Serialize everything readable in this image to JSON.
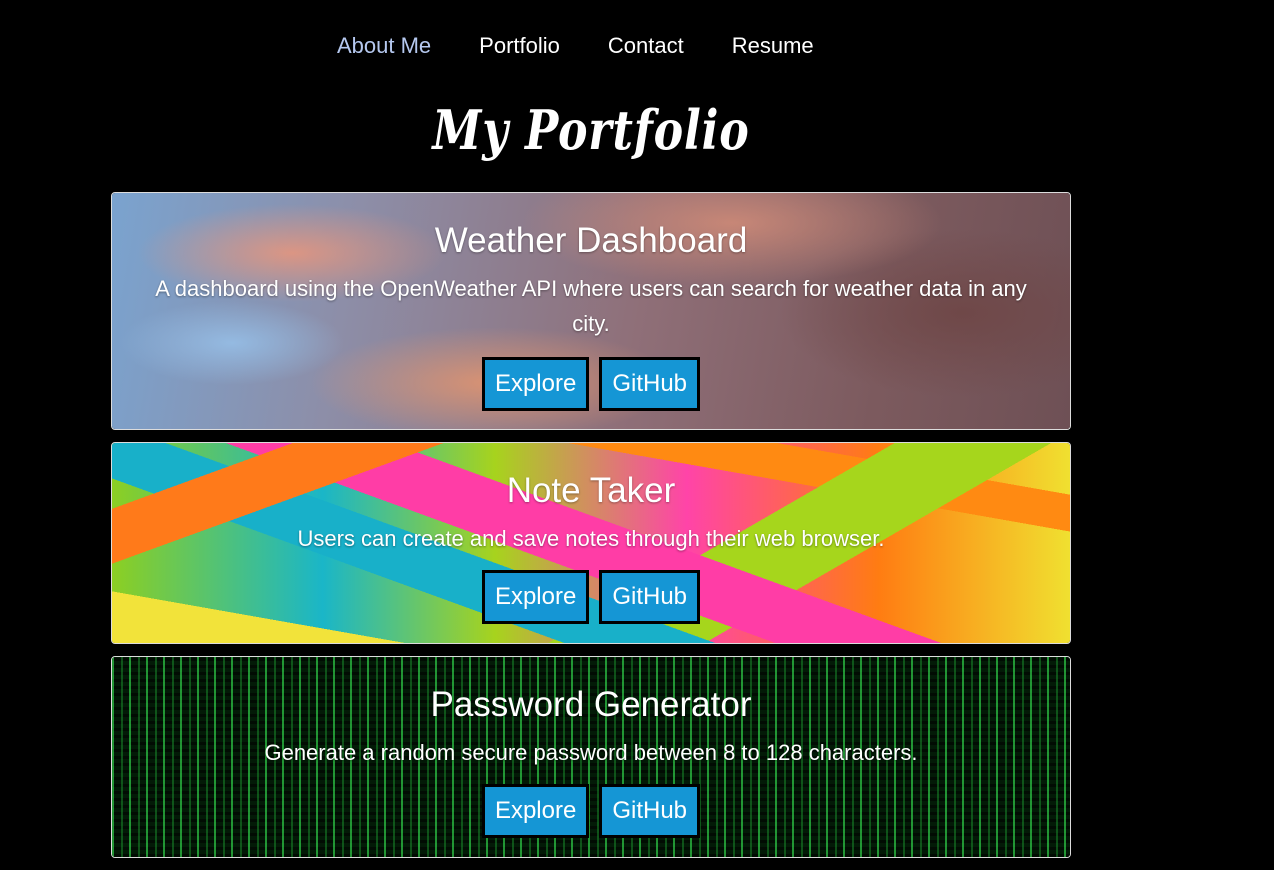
{
  "nav": {
    "items": [
      {
        "label": "About Me"
      },
      {
        "label": "Portfolio"
      },
      {
        "label": "Contact"
      },
      {
        "label": "Resume"
      }
    ]
  },
  "page": {
    "title": "My Portfolio"
  },
  "projects": [
    {
      "title": "Weather Dashboard",
      "description": "A dashboard using the OpenWeather API where users can search for weather data in any city.",
      "explore_label": "Explore",
      "github_label": "GitHub"
    },
    {
      "title": "Note Taker",
      "description": "Users can create and save notes through their web browser.",
      "explore_label": "Explore",
      "github_label": "GitHub"
    },
    {
      "title": "Password Generator",
      "description": "Generate a random secure password between 8 to 128 characters.",
      "explore_label": "Explore",
      "github_label": "GitHub"
    }
  ],
  "colors": {
    "background": "#000000",
    "button": "#1596d5",
    "nav_active": "#b5c8ef"
  }
}
